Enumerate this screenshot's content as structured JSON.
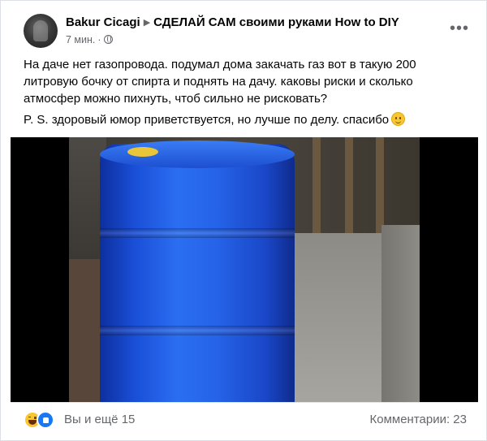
{
  "post": {
    "author": "Bakur Cicagi",
    "group": "СДЕЛАЙ САМ своими руками How to DIY",
    "time": "7 мин.",
    "meta_separator": "·",
    "paragraphs": [
      "На даче нет газопровода. подумал дома закачать газ  вот в такую 200 литровую бочку от спирта и поднять на дачу. каковы риски и сколько атмосфер можно пихнуть, чтоб сильно не рисковать?",
      "P. S. здоровый юмор приветствуется, но лучше по делу. спасибо"
    ],
    "more_label": "•••"
  },
  "footer": {
    "reactions_text": "Вы и ещё 15",
    "comments_text": "Комментарии: 23"
  },
  "icons": {
    "group_arrow": "triangle-right",
    "audience": "globe-icon",
    "reactions": [
      "haha-icon",
      "like-icon"
    ]
  },
  "colors": {
    "secondary_text": "#65676b",
    "like_blue": "#1877f2",
    "haha_yellow": "#f7c631"
  }
}
